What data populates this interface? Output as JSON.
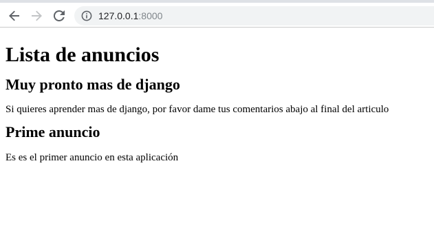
{
  "browser": {
    "url_host": "127.0.0.1",
    "url_port": ":8000",
    "icons": {
      "back": "back-arrow-icon",
      "forward": "forward-arrow-icon",
      "reload": "reload-icon",
      "site_info": "info-icon"
    },
    "colors": {
      "toolbar_bg": "#ffffff",
      "omnibox_bg": "#f1f3f4",
      "icon_active": "#5f6368",
      "icon_disabled": "#c2c4c6"
    }
  },
  "page": {
    "title": "Lista de anuncios",
    "anuncios": [
      {
        "titulo": "Muy pronto mas de django",
        "texto": "Si quieres aprender mas de django, por favor dame tus comentarios abajo al final del articulo"
      },
      {
        "titulo": "Prime anuncio",
        "texto": "Es es el primer anuncio en esta aplicación"
      }
    ]
  }
}
